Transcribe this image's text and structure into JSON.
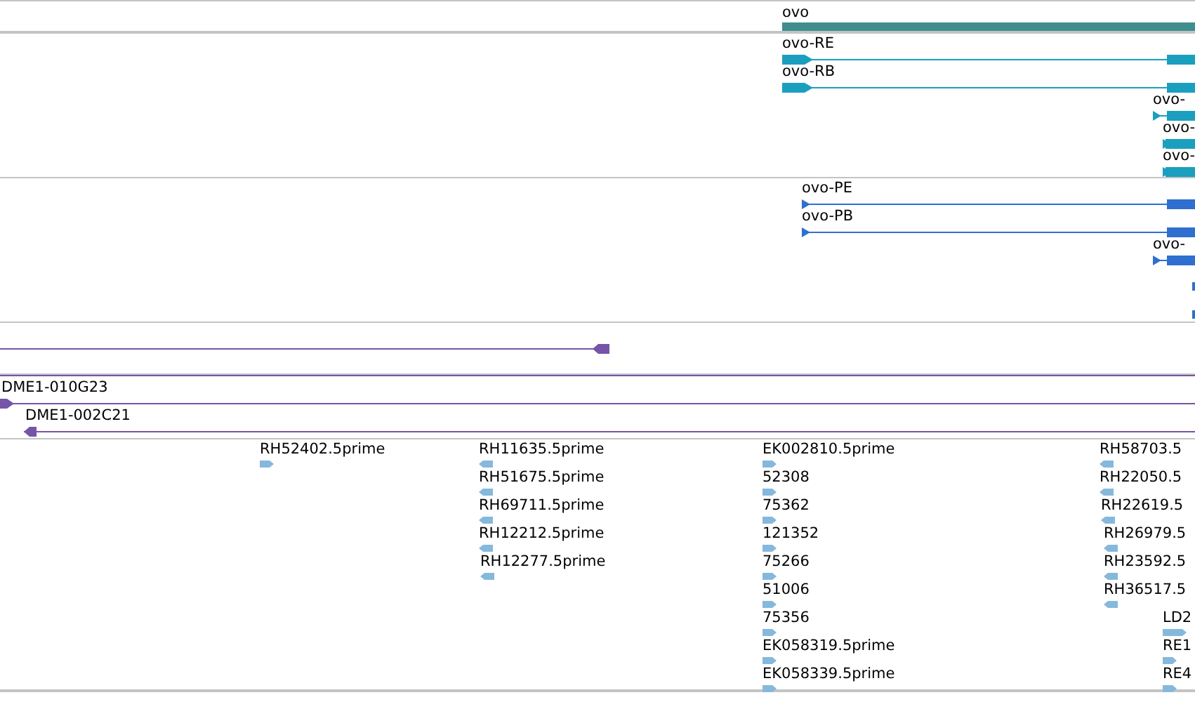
{
  "gene_track": {
    "features": [
      {
        "label": "ovo"
      }
    ]
  },
  "transcript_track": {
    "features": [
      {
        "label": "ovo-RE"
      },
      {
        "label": "ovo-RB"
      },
      {
        "label": "ovo-"
      },
      {
        "label": "ovo-"
      },
      {
        "label": "ovo-"
      }
    ]
  },
  "protein_track": {
    "features": [
      {
        "label": "ovo-PE"
      },
      {
        "label": "ovo-PB"
      },
      {
        "label": "ovo-"
      }
    ]
  },
  "clone_track": {
    "features": [
      {
        "label": "DME1-010G23",
        "reverse": false
      },
      {
        "label": "DME1-002C21",
        "reverse": true
      }
    ]
  },
  "est_track": {
    "features": [
      {
        "label": "RH52402.5prime",
        "reverse": false
      },
      {
        "label": "RH11635.5prime",
        "reverse": true
      },
      {
        "label": "RH51675.5prime",
        "reverse": true
      },
      {
        "label": "RH69711.5prime",
        "reverse": true
      },
      {
        "label": "RH12212.5prime",
        "reverse": true
      },
      {
        "label": "RH12277.5prime",
        "reverse": true
      },
      {
        "label": "EK002810.5prime",
        "reverse": false
      },
      {
        "label": "52308",
        "reverse": false
      },
      {
        "label": "75362",
        "reverse": false
      },
      {
        "label": "121352",
        "reverse": false
      },
      {
        "label": "75266",
        "reverse": false
      },
      {
        "label": "51006",
        "reverse": false
      },
      {
        "label": "75356",
        "reverse": false
      },
      {
        "label": "EK058319.5prime",
        "reverse": false
      },
      {
        "label": "EK058339.5prime",
        "reverse": false
      },
      {
        "label": "RH58703.5",
        "reverse": true
      },
      {
        "label": "RH22050.5",
        "reverse": true
      },
      {
        "label": "RH22619.5",
        "reverse": true
      },
      {
        "label": "RH26979.5",
        "reverse": true
      },
      {
        "label": "RH23592.5",
        "reverse": true
      },
      {
        "label": "RH36517.5",
        "reverse": true
      },
      {
        "label": "LD2",
        "reverse": false
      },
      {
        "label": "RE1",
        "reverse": false
      },
      {
        "label": "RE4",
        "reverse": false
      }
    ]
  }
}
